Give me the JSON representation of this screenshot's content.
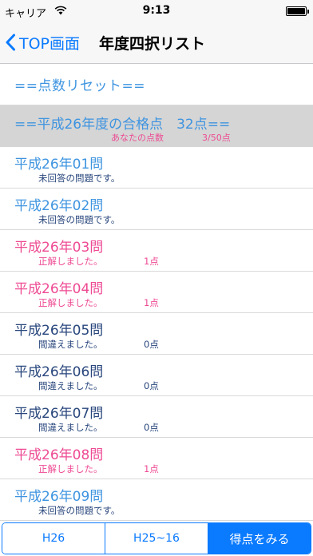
{
  "status_bar": {
    "carrier": "キャリア",
    "time": "9:13"
  },
  "nav": {
    "back_label": "TOP画面",
    "title": "年度四択リスト"
  },
  "list": {
    "reset_label": "==点数リセット==",
    "summary": {
      "main": "==平成26年度の合格点　32点==",
      "your_score_label": "あなたの点数",
      "your_score": "3/50点"
    },
    "items": [
      {
        "title": "平成26年01問",
        "status": "未回答の問題です。",
        "score": "",
        "state": "unanswered"
      },
      {
        "title": "平成26年02問",
        "status": "未回答の問題です。",
        "score": "",
        "state": "unanswered"
      },
      {
        "title": "平成26年03問",
        "status": "正解しました。",
        "score": "1点",
        "state": "correct"
      },
      {
        "title": "平成26年04問",
        "status": "正解しました。",
        "score": "1点",
        "state": "correct"
      },
      {
        "title": "平成26年05問",
        "status": "間違えました。",
        "score": "0点",
        "state": "wrong"
      },
      {
        "title": "平成26年06問",
        "status": "間違えました。",
        "score": "0点",
        "state": "wrong"
      },
      {
        "title": "平成26年07問",
        "status": "間違えました。",
        "score": "0点",
        "state": "wrong"
      },
      {
        "title": "平成26年08問",
        "status": "正解しました。",
        "score": "1点",
        "state": "correct"
      },
      {
        "title": "平成26年09問",
        "status": "未回答の問題です。",
        "score": "",
        "state": "unanswered"
      }
    ]
  },
  "tabs": [
    {
      "label": "H26",
      "active": false
    },
    {
      "label": "H25~16",
      "active": false
    },
    {
      "label": "得点をみる",
      "active": true
    }
  ],
  "colors": {
    "accent": "#0a7aff",
    "unanswered_title": "#3e94e0",
    "correct": "#ee4a93",
    "wrong": "#28467c"
  },
  "icons": {
    "back": "chevron-left-icon",
    "wifi": "wifi-icon",
    "battery": "battery-icon"
  }
}
